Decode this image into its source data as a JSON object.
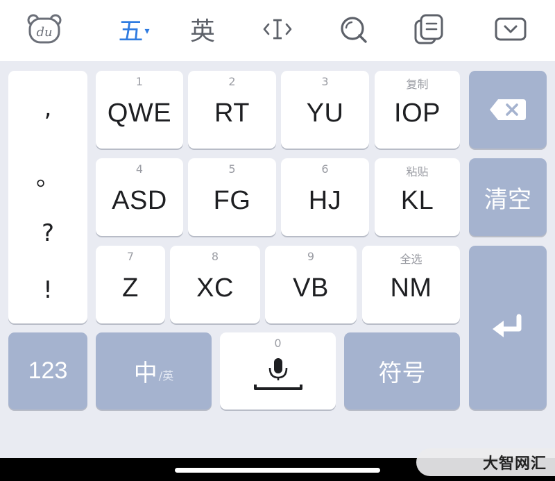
{
  "toolbar": {
    "items": [
      {
        "name": "du-logo-icon"
      },
      {
        "label": "五",
        "caret": "▾",
        "active": true
      },
      {
        "label": "英"
      },
      {
        "name": "cursor-move-icon"
      },
      {
        "name": "search-icon"
      },
      {
        "name": "clipboard-icon"
      },
      {
        "name": "collapse-keyboard-icon"
      }
    ],
    "logo_text": "du"
  },
  "punctuation": [
    ",",
    "。",
    "?",
    "!"
  ],
  "letter_keys": [
    {
      "label": "QWE",
      "sub": "1"
    },
    {
      "label": "RT",
      "sub": "2"
    },
    {
      "label": "YU",
      "sub": "3"
    },
    {
      "label": "IOP",
      "sub": "复制"
    },
    {
      "label": "ASD",
      "sub": "4"
    },
    {
      "label": "FG",
      "sub": "5"
    },
    {
      "label": "HJ",
      "sub": "6"
    },
    {
      "label": "KL",
      "sub": "粘贴"
    },
    {
      "label": "Z",
      "sub": "7"
    },
    {
      "label": "XC",
      "sub": "8"
    },
    {
      "label": "VB",
      "sub": "9"
    },
    {
      "label": "NM",
      "sub": "全选"
    }
  ],
  "function_keys": {
    "backspace": "backspace-icon",
    "clear": "清空",
    "enter": "enter-icon",
    "numbers": "123",
    "lang_main": "中",
    "lang_sub": "/英",
    "space_sub": "0",
    "symbols": "符号"
  },
  "watermark": "大智网汇",
  "colors": {
    "keyboard_bg": "#e9ebf2",
    "key_white": "#ffffff",
    "key_gray": "#a5b3cf",
    "accent": "#2f7be0"
  }
}
